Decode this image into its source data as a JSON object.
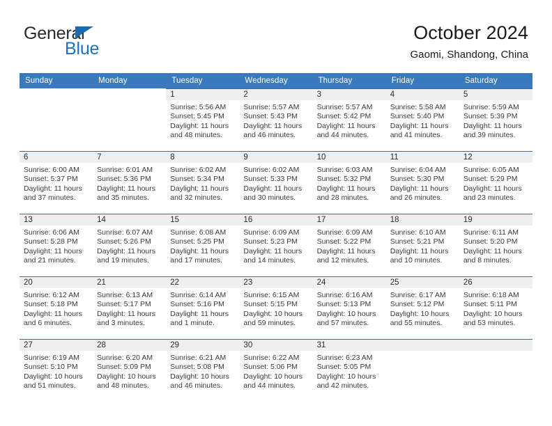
{
  "brand": {
    "name_top": "General",
    "name_bottom": "Blue",
    "triangle_color": "#1a6bb0",
    "blue_color": "#1a72c0",
    "dark_color": "#2a2a2a"
  },
  "header": {
    "title": "October 2024",
    "subtitle": "Gaomi, Shandong, China"
  },
  "theme": {
    "header_blue": "#3a79bd",
    "separator_blue": "#2f6fb0",
    "day_band_gray": "#efefef",
    "text_dark": "#2b2b2b",
    "text_body": "#3a3a3a"
  },
  "weekday_headers": [
    "Sunday",
    "Monday",
    "Tuesday",
    "Wednesday",
    "Thursday",
    "Friday",
    "Saturday"
  ],
  "labels": {
    "sunrise_prefix": "Sunrise:",
    "sunset_prefix": "Sunset:",
    "daylight_prefix": "Daylight:"
  },
  "weeks": [
    [
      {
        "day": "",
        "blank": true,
        "sunrise": "",
        "sunset": "",
        "daylight": ""
      },
      {
        "day": "",
        "blank": true,
        "sunrise": "",
        "sunset": "",
        "daylight": ""
      },
      {
        "day": "1",
        "sunrise": "Sunrise: 5:56 AM",
        "sunset": "Sunset: 5:45 PM",
        "daylight": "Daylight: 11 hours and 48 minutes."
      },
      {
        "day": "2",
        "sunrise": "Sunrise: 5:57 AM",
        "sunset": "Sunset: 5:43 PM",
        "daylight": "Daylight: 11 hours and 46 minutes."
      },
      {
        "day": "3",
        "sunrise": "Sunrise: 5:57 AM",
        "sunset": "Sunset: 5:42 PM",
        "daylight": "Daylight: 11 hours and 44 minutes."
      },
      {
        "day": "4",
        "sunrise": "Sunrise: 5:58 AM",
        "sunset": "Sunset: 5:40 PM",
        "daylight": "Daylight: 11 hours and 41 minutes."
      },
      {
        "day": "5",
        "sunrise": "Sunrise: 5:59 AM",
        "sunset": "Sunset: 5:39 PM",
        "daylight": "Daylight: 11 hours and 39 minutes."
      }
    ],
    [
      {
        "day": "6",
        "sunrise": "Sunrise: 6:00 AM",
        "sunset": "Sunset: 5:37 PM",
        "daylight": "Daylight: 11 hours and 37 minutes."
      },
      {
        "day": "7",
        "sunrise": "Sunrise: 6:01 AM",
        "sunset": "Sunset: 5:36 PM",
        "daylight": "Daylight: 11 hours and 35 minutes."
      },
      {
        "day": "8",
        "sunrise": "Sunrise: 6:02 AM",
        "sunset": "Sunset: 5:34 PM",
        "daylight": "Daylight: 11 hours and 32 minutes."
      },
      {
        "day": "9",
        "sunrise": "Sunrise: 6:02 AM",
        "sunset": "Sunset: 5:33 PM",
        "daylight": "Daylight: 11 hours and 30 minutes."
      },
      {
        "day": "10",
        "sunrise": "Sunrise: 6:03 AM",
        "sunset": "Sunset: 5:32 PM",
        "daylight": "Daylight: 11 hours and 28 minutes."
      },
      {
        "day": "11",
        "sunrise": "Sunrise: 6:04 AM",
        "sunset": "Sunset: 5:30 PM",
        "daylight": "Daylight: 11 hours and 26 minutes."
      },
      {
        "day": "12",
        "sunrise": "Sunrise: 6:05 AM",
        "sunset": "Sunset: 5:29 PM",
        "daylight": "Daylight: 11 hours and 23 minutes."
      }
    ],
    [
      {
        "day": "13",
        "sunrise": "Sunrise: 6:06 AM",
        "sunset": "Sunset: 5:28 PM",
        "daylight": "Daylight: 11 hours and 21 minutes."
      },
      {
        "day": "14",
        "sunrise": "Sunrise: 6:07 AM",
        "sunset": "Sunset: 5:26 PM",
        "daylight": "Daylight: 11 hours and 19 minutes."
      },
      {
        "day": "15",
        "sunrise": "Sunrise: 6:08 AM",
        "sunset": "Sunset: 5:25 PM",
        "daylight": "Daylight: 11 hours and 17 minutes."
      },
      {
        "day": "16",
        "sunrise": "Sunrise: 6:09 AM",
        "sunset": "Sunset: 5:23 PM",
        "daylight": "Daylight: 11 hours and 14 minutes."
      },
      {
        "day": "17",
        "sunrise": "Sunrise: 6:09 AM",
        "sunset": "Sunset: 5:22 PM",
        "daylight": "Daylight: 11 hours and 12 minutes."
      },
      {
        "day": "18",
        "sunrise": "Sunrise: 6:10 AM",
        "sunset": "Sunset: 5:21 PM",
        "daylight": "Daylight: 11 hours and 10 minutes."
      },
      {
        "day": "19",
        "sunrise": "Sunrise: 6:11 AM",
        "sunset": "Sunset: 5:20 PM",
        "daylight": "Daylight: 11 hours and 8 minutes."
      }
    ],
    [
      {
        "day": "20",
        "sunrise": "Sunrise: 6:12 AM",
        "sunset": "Sunset: 5:18 PM",
        "daylight": "Daylight: 11 hours and 6 minutes."
      },
      {
        "day": "21",
        "sunrise": "Sunrise: 6:13 AM",
        "sunset": "Sunset: 5:17 PM",
        "daylight": "Daylight: 11 hours and 3 minutes."
      },
      {
        "day": "22",
        "sunrise": "Sunrise: 6:14 AM",
        "sunset": "Sunset: 5:16 PM",
        "daylight": "Daylight: 11 hours and 1 minute."
      },
      {
        "day": "23",
        "sunrise": "Sunrise: 6:15 AM",
        "sunset": "Sunset: 5:15 PM",
        "daylight": "Daylight: 10 hours and 59 minutes."
      },
      {
        "day": "24",
        "sunrise": "Sunrise: 6:16 AM",
        "sunset": "Sunset: 5:13 PM",
        "daylight": "Daylight: 10 hours and 57 minutes."
      },
      {
        "day": "25",
        "sunrise": "Sunrise: 6:17 AM",
        "sunset": "Sunset: 5:12 PM",
        "daylight": "Daylight: 10 hours and 55 minutes."
      },
      {
        "day": "26",
        "sunrise": "Sunrise: 6:18 AM",
        "sunset": "Sunset: 5:11 PM",
        "daylight": "Daylight: 10 hours and 53 minutes."
      }
    ],
    [
      {
        "day": "27",
        "sunrise": "Sunrise: 6:19 AM",
        "sunset": "Sunset: 5:10 PM",
        "daylight": "Daylight: 10 hours and 51 minutes."
      },
      {
        "day": "28",
        "sunrise": "Sunrise: 6:20 AM",
        "sunset": "Sunset: 5:09 PM",
        "daylight": "Daylight: 10 hours and 48 minutes."
      },
      {
        "day": "29",
        "sunrise": "Sunrise: 6:21 AM",
        "sunset": "Sunset: 5:08 PM",
        "daylight": "Daylight: 10 hours and 46 minutes."
      },
      {
        "day": "30",
        "sunrise": "Sunrise: 6:22 AM",
        "sunset": "Sunset: 5:06 PM",
        "daylight": "Daylight: 10 hours and 44 minutes."
      },
      {
        "day": "31",
        "sunrise": "Sunrise: 6:23 AM",
        "sunset": "Sunset: 5:05 PM",
        "daylight": "Daylight: 10 hours and 42 minutes."
      },
      {
        "day": "",
        "empty": true,
        "sunrise": "",
        "sunset": "",
        "daylight": ""
      },
      {
        "day": "",
        "empty": true,
        "sunrise": "",
        "sunset": "",
        "daylight": ""
      }
    ]
  ]
}
